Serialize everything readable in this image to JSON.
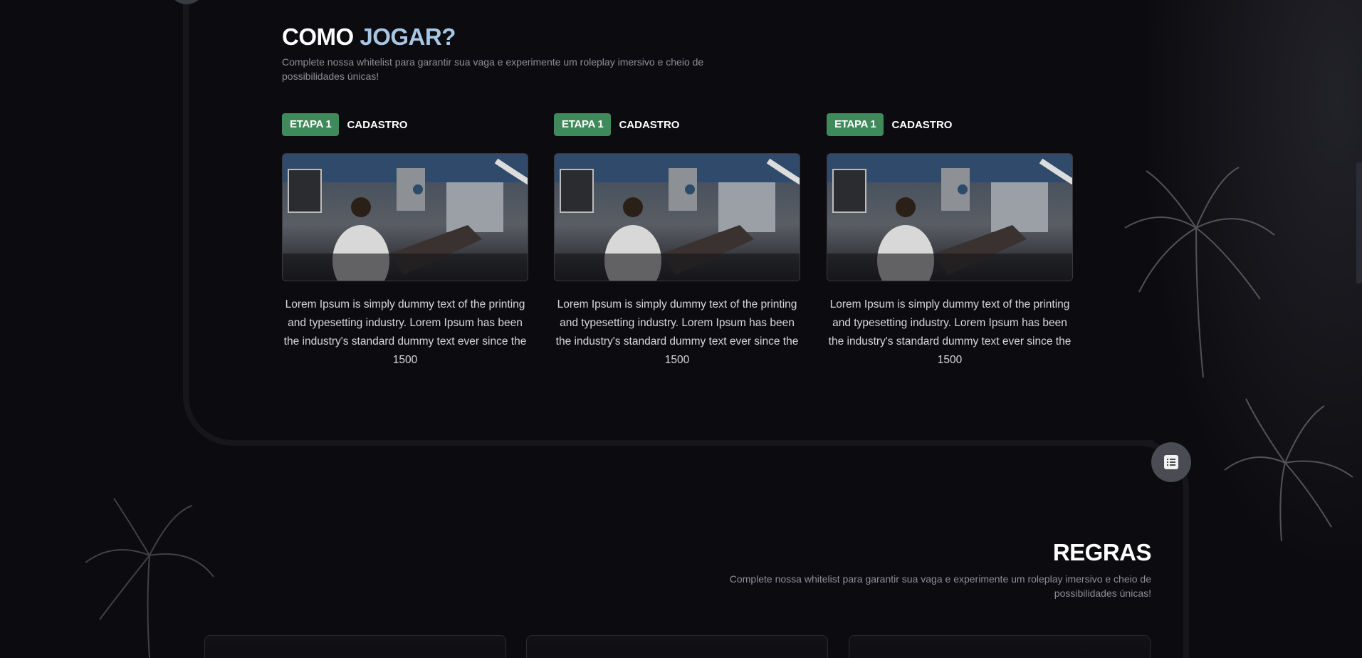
{
  "how_to_play": {
    "title_part1": "COMO",
    "title_part2": "JOGAR?",
    "subtitle": "Complete nossa whitelist para garantir sua vaga e experimente um roleplay imersivo e cheio de possibilidades únicas!",
    "steps": [
      {
        "badge": "ETAPA 1",
        "label": "CADASTRO",
        "description": "Lorem Ipsum is simply dummy text of the printing and typesetting industry. Lorem Ipsum has been the industry's standard dummy text ever since the 1500"
      },
      {
        "badge": "ETAPA 1",
        "label": "CADASTRO",
        "description": "Lorem Ipsum is simply dummy text of the printing and typesetting industry. Lorem Ipsum has been the industry's standard dummy text ever since the 1500"
      },
      {
        "badge": "ETAPA 1",
        "label": "CADASTRO",
        "description": "Lorem Ipsum is simply dummy text of the printing and typesetting industry. Lorem Ipsum has been the industry's standard dummy text ever since the 1500"
      }
    ]
  },
  "rules": {
    "title": "REGRAS",
    "subtitle": "Complete nossa whitelist para garantir sua vaga e experimente um roleplay imersivo e cheio de possibilidades únicas!"
  },
  "icons": {
    "section_node": "list-icon"
  },
  "colors": {
    "background": "#0c0c10",
    "accent_blue": "#a7c6e4",
    "badge_green": "#3f8a5a"
  }
}
